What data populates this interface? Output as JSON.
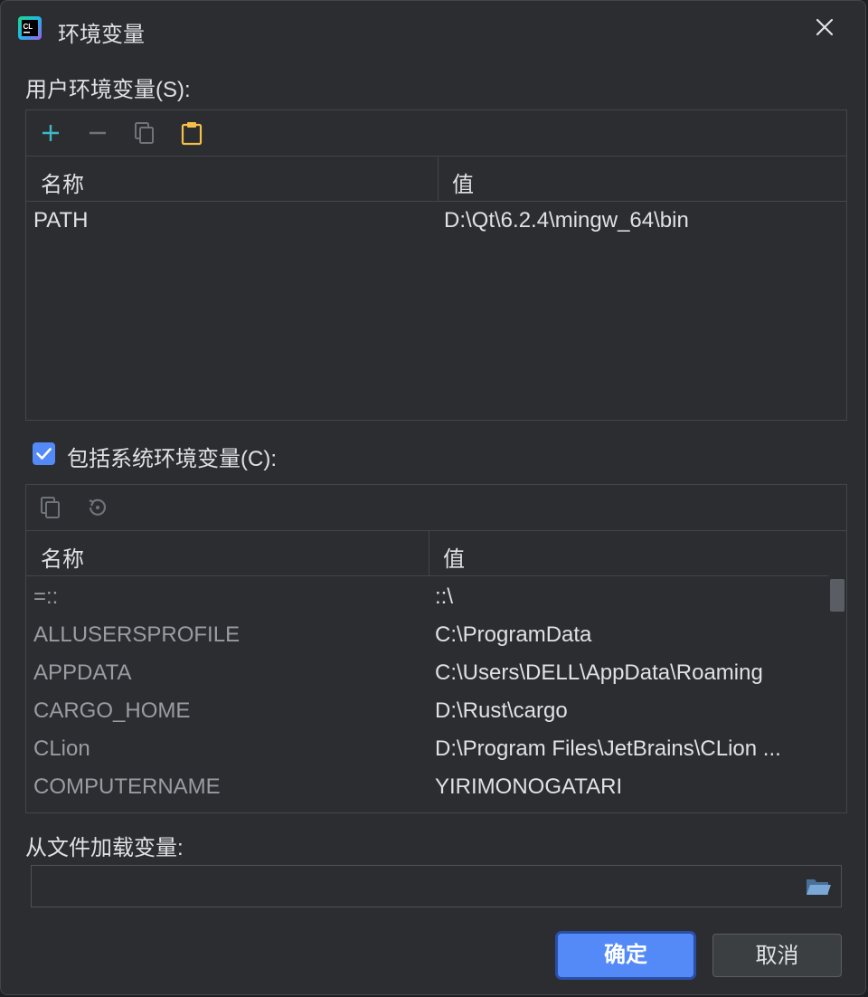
{
  "window": {
    "title": "环境变量"
  },
  "user_env": {
    "label": "用户环境变量(S):",
    "toolbar": [
      "add-icon",
      "remove-icon",
      "copy-icon",
      "paste-icon"
    ],
    "columns": [
      "名称",
      "值"
    ],
    "rows": [
      {
        "name": "PATH",
        "value": "D:\\Qt\\6.2.4\\mingw_64\\bin"
      }
    ]
  },
  "system_env": {
    "include_label": "包括系统环境变量(C):",
    "include_checked": true,
    "toolbar": [
      "copy-icon",
      "reset-icon"
    ],
    "columns": [
      "名称",
      "值"
    ],
    "rows": [
      {
        "name": "=::",
        "value": "::\\"
      },
      {
        "name": "ALLUSERSPROFILE",
        "value": "C:\\ProgramData"
      },
      {
        "name": "APPDATA",
        "value": "C:\\Users\\DELL\\AppData\\Roaming"
      },
      {
        "name": "CARGO_HOME",
        "value": "D:\\Rust\\cargo"
      },
      {
        "name": "CLion",
        "value": "D:\\Program Files\\JetBrains\\CLion ..."
      },
      {
        "name": "COMPUTERNAME",
        "value": "YIRIMONOGATARI"
      }
    ]
  },
  "load_from_file": {
    "label": "从文件加载变量:",
    "value": ""
  },
  "buttons": {
    "ok": "确定",
    "cancel": "取消"
  },
  "colors": {
    "background": "#2b2d30",
    "accent": "#548af7",
    "add_icon": "#3fb8c9",
    "paste_icon": "#f4c04a",
    "dim_text": "#9a9ca3",
    "folder_icon": "#7aa7d6"
  }
}
